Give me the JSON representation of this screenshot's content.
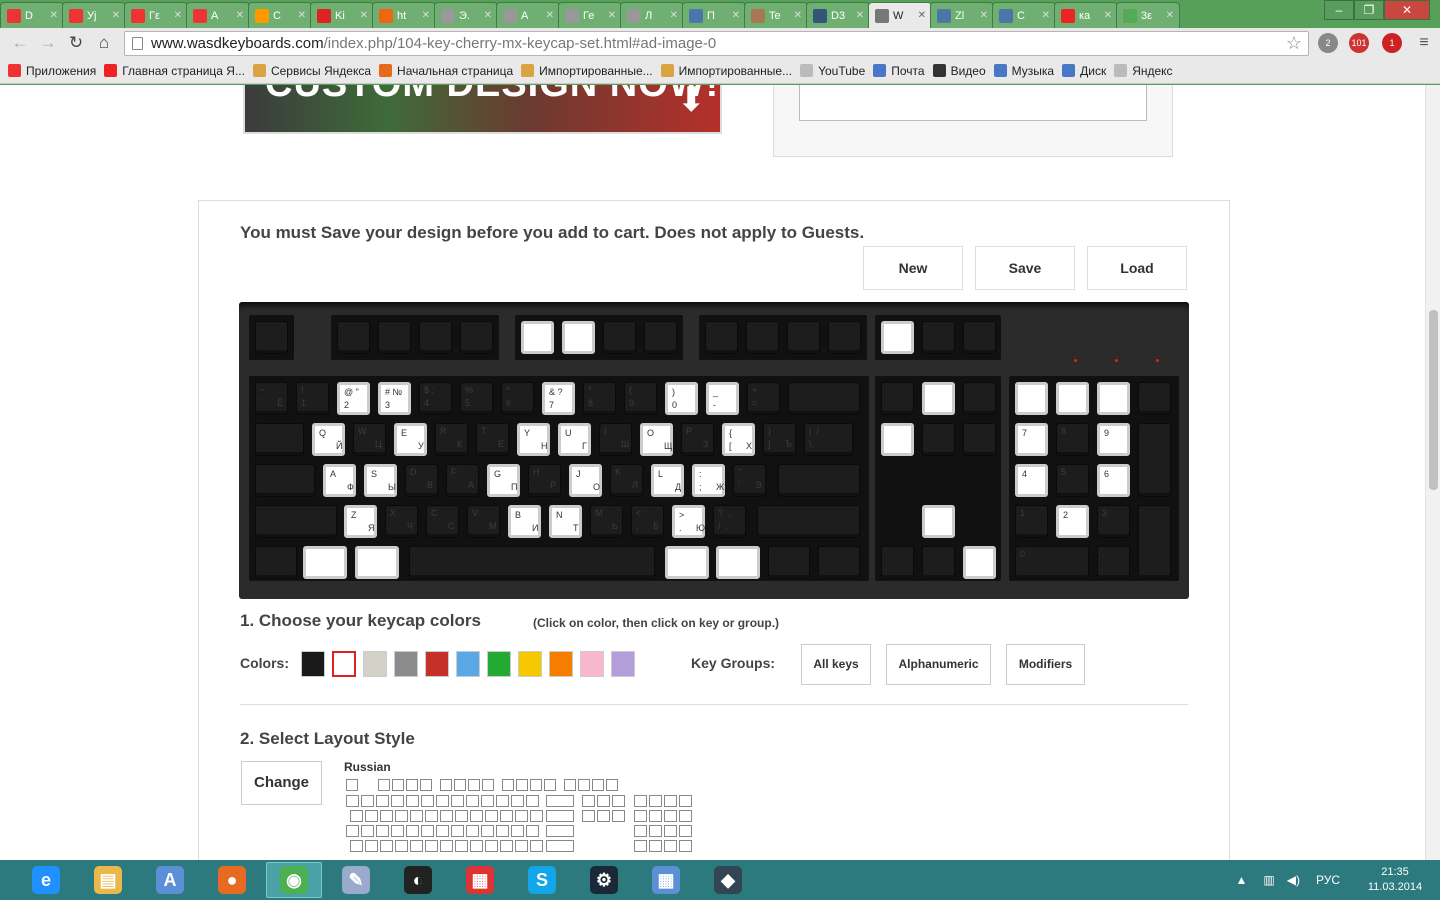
{
  "browser": {
    "tabs": [
      {
        "label": "D",
        "color": "#e33"
      },
      {
        "label": "Уј",
        "color": "#e33"
      },
      {
        "label": "Гε",
        "color": "#e33"
      },
      {
        "label": "A",
        "color": "#e33"
      },
      {
        "label": "C",
        "color": "#f90"
      },
      {
        "label": "Ki",
        "color": "#d22"
      },
      {
        "label": "ht",
        "color": "#e61"
      },
      {
        "label": "Э.",
        "color": "#999"
      },
      {
        "label": "A",
        "color": "#999"
      },
      {
        "label": "Ге",
        "color": "#999"
      },
      {
        "label": "Л",
        "color": "#999"
      },
      {
        "label": "П",
        "color": "#4a76a8"
      },
      {
        "label": "Te",
        "color": "#a75"
      },
      {
        "label": "D3",
        "color": "#357"
      },
      {
        "label": "W",
        "color": "#777",
        "active": true
      },
      {
        "label": "Zl",
        "color": "#4a76a8"
      },
      {
        "label": "C",
        "color": "#4a76a8"
      },
      {
        "label": "ка",
        "color": "#e22"
      },
      {
        "label": "3ε",
        "color": "#5a5"
      }
    ],
    "url_host": "www.wasdkeyboards.com",
    "url_path": "/index.php/104-key-cherry-mx-keycap-set.html#ad-image-0",
    "badge_mail": "2",
    "badge_count": "101",
    "badge_alert": "1",
    "bookmarks": [
      {
        "label": "Приложения",
        "color": "#e33"
      },
      {
        "label": "Главная страница Я...",
        "color": "#e22"
      },
      {
        "label": "Сервисы Яндекса",
        "color": "#d9a441"
      },
      {
        "label": "Начальная страница",
        "color": "#e76a1a"
      },
      {
        "label": "Импортированные...",
        "color": "#d9a441"
      },
      {
        "label": "Импортированные...",
        "color": "#d9a441"
      },
      {
        "label": "YouTube",
        "color": "#bbb"
      },
      {
        "label": "Почта",
        "color": "#4a76c8"
      },
      {
        "label": "Видео",
        "color": "#333"
      },
      {
        "label": "Музыка",
        "color": "#4a76c8"
      },
      {
        "label": "Диск",
        "color": "#4a76c8"
      },
      {
        "label": "Яндекс",
        "color": "#bbb"
      }
    ]
  },
  "page": {
    "notice": "You must Save your design before you add to cart. Does not apply to Guests.",
    "buttons": {
      "new": "New",
      "save": "Save",
      "load": "Load"
    },
    "section1": {
      "title": "1. Choose your keycap colors",
      "hint": "(Click on color, then click on key or group.)",
      "colors_label": "Colors:",
      "colors": [
        "#1a1a1a",
        "#ffffff",
        "#d4d2c8",
        "#8c8c8c",
        "#c43129",
        "#5aa9e6",
        "#22aa33",
        "#f5c800",
        "#f57d00",
        "#f7b8cc",
        "#b39ddb"
      ],
      "selected_color": 1,
      "groups_label": "Key Groups:",
      "groups": [
        "All keys",
        "Alphanumeric",
        "Modifiers"
      ]
    },
    "section2": {
      "title": "2. Select Layout Style",
      "change": "Change",
      "layout_name": "Russian"
    }
  },
  "keyboard": {
    "rows": [
      {
        "keys": [
          {
            "t": "~",
            "b": "`",
            "r": "Ё"
          },
          {
            "t": "!",
            "b": "1"
          },
          {
            "t": "@ \"",
            "b": "2",
            "w": 1
          },
          {
            "t": "# №",
            "b": "3",
            "w": 1
          },
          {
            "t": "$ ;",
            "b": "4"
          },
          {
            "t": "%",
            "b": "5"
          },
          {
            "t": "^ :",
            "b": "6"
          },
          {
            "t": "& ?",
            "b": "7",
            "w": 1
          },
          {
            "t": "*",
            "b": "8"
          },
          {
            "t": "(",
            "b": "9"
          },
          {
            "t": ")",
            "b": "0",
            "w": 1
          },
          {
            "t": "_",
            "b": "-",
            "w": 1
          },
          {
            "t": "+",
            "b": "="
          }
        ]
      },
      {
        "keys": [
          {
            "t": "Q",
            "r": "Й",
            "w": 1
          },
          {
            "t": "W",
            "r": "Ц"
          },
          {
            "t": "E",
            "r": "У",
            "w": 1
          },
          {
            "t": "R",
            "r": "К"
          },
          {
            "t": "T",
            "r": "Е"
          },
          {
            "t": "Y",
            "r": "Н",
            "w": 1
          },
          {
            "t": "U",
            "r": "Г",
            "w": 1
          },
          {
            "t": "I",
            "r": "Ш"
          },
          {
            "t": "O",
            "r": "Щ",
            "w": 1
          },
          {
            "t": "P",
            "r": "З"
          },
          {
            "t": "{",
            "b": "[",
            "r": "Х",
            "w": 1
          },
          {
            "t": "}",
            "b": "]",
            "r": "Ъ"
          },
          {
            "t": "|  /",
            "b": "\\"
          }
        ]
      },
      {
        "keys": [
          {
            "t": "A",
            "r": "Ф",
            "w": 1
          },
          {
            "t": "S",
            "r": "Ы",
            "w": 1
          },
          {
            "t": "D",
            "r": "В"
          },
          {
            "t": "F",
            "r": "А"
          },
          {
            "t": "G",
            "r": "П",
            "w": 1
          },
          {
            "t": "H",
            "r": "Р"
          },
          {
            "t": "J",
            "r": "О",
            "w": 1
          },
          {
            "t": "K",
            "r": "Л"
          },
          {
            "t": "L",
            "r": "Д",
            "w": 1
          },
          {
            "t": ":",
            "b": ";",
            "r": "Ж",
            "w": 1
          },
          {
            "t": "\"",
            "b": "'",
            "r": "Э"
          }
        ]
      },
      {
        "keys": [
          {
            "t": "Z",
            "r": "Я",
            "w": 1
          },
          {
            "t": "X",
            "r": "Ч"
          },
          {
            "t": "C",
            "r": "С"
          },
          {
            "t": "V",
            "r": "М"
          },
          {
            "t": "B",
            "r": "И",
            "w": 1
          },
          {
            "t": "N",
            "r": "Т",
            "w": 1
          },
          {
            "t": "M",
            "r": "Ь"
          },
          {
            "t": "<",
            "b": ",",
            "r": "Б"
          },
          {
            "t": ">",
            "b": ".",
            "r": "Ю",
            "w": 1
          },
          {
            "t": "?  ,",
            "b": "/  ."
          }
        ]
      }
    ],
    "numpad": {
      "k7": "7",
      "k8": "8",
      "k9": "9",
      "k4": "4",
      "k5": "5",
      "k6": "6",
      "k1": "1",
      "k2": "2",
      "k3": "3",
      "k0": "0",
      "kdot": "."
    }
  },
  "taskbar": {
    "apps": [
      {
        "name": "ie",
        "color": "#1e90ff",
        "glyph": "e"
      },
      {
        "name": "explorer",
        "color": "#e8b84a",
        "glyph": "▤"
      },
      {
        "name": "notepad",
        "color": "#5b8fd6",
        "glyph": "A"
      },
      {
        "name": "firefox",
        "color": "#e66a1f",
        "glyph": "●"
      },
      {
        "name": "chrome",
        "color": "#4caf50",
        "glyph": "◉",
        "active": true
      },
      {
        "name": "paint",
        "color": "#9ac",
        "glyph": "✎"
      },
      {
        "name": "obs",
        "color": "#222",
        "glyph": "◐"
      },
      {
        "name": "apps",
        "color": "#d33",
        "glyph": "▦"
      },
      {
        "name": "skype",
        "color": "#12a5e8",
        "glyph": "S"
      },
      {
        "name": "steam",
        "color": "#1b2838",
        "glyph": "⚙"
      },
      {
        "name": "calculator",
        "color": "#5b8fd6",
        "glyph": "▦"
      },
      {
        "name": "dota",
        "color": "#345",
        "glyph": "◆"
      }
    ],
    "lang": "РУС",
    "time": "21:35",
    "date": "11.03.2014"
  }
}
